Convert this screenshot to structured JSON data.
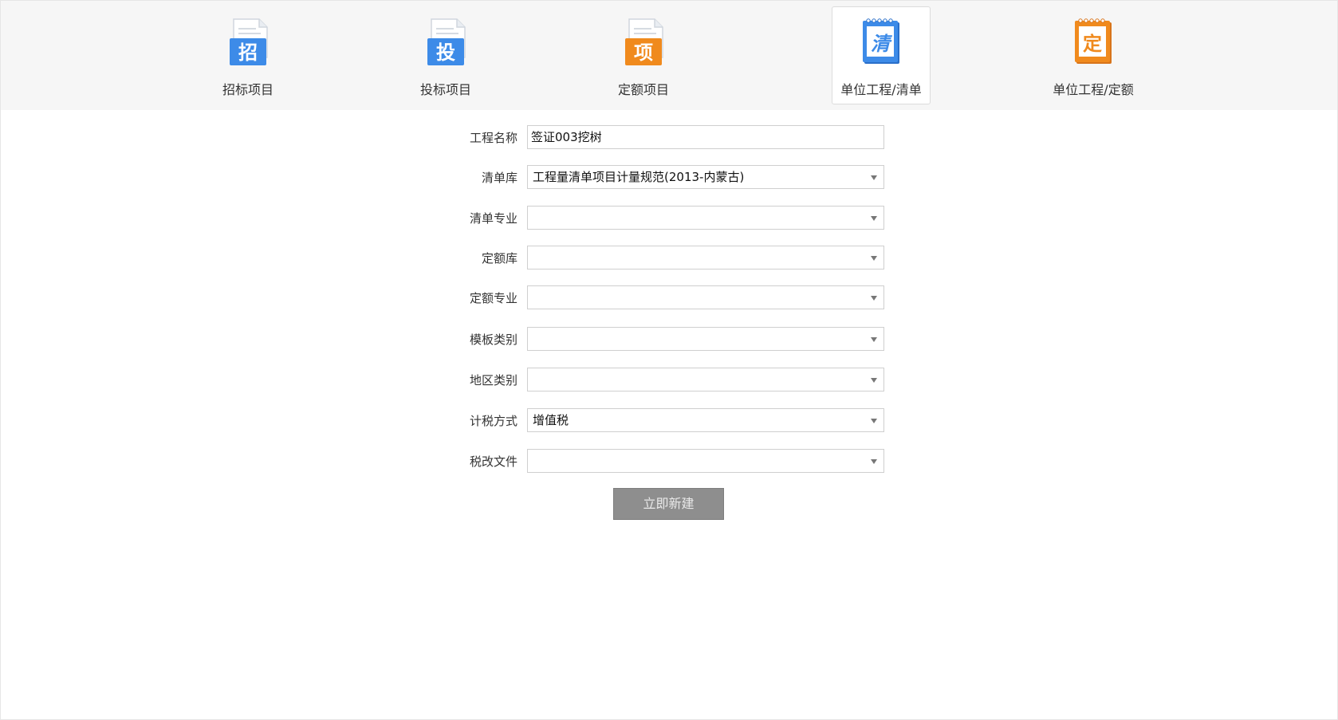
{
  "tabs": [
    {
      "label": "招标项目",
      "icon": "zhao-doc-icon",
      "glyph": "招",
      "color": "#3d8be8",
      "active": false
    },
    {
      "label": "投标项目",
      "icon": "tou-doc-icon",
      "glyph": "投",
      "color": "#3d8be8",
      "active": false
    },
    {
      "label": "定额项目",
      "icon": "xiang-doc-icon",
      "glyph": "项",
      "color": "#f08a1d",
      "active": false
    },
    {
      "label": "单位工程/清单",
      "icon": "qing-notepad-icon",
      "glyph": "清",
      "color": "#3d8be8",
      "active": true
    },
    {
      "label": "单位工程/定额",
      "icon": "ding-notepad-icon",
      "glyph": "定",
      "color": "#f08a1d",
      "active": false
    }
  ],
  "form": {
    "project_name": {
      "label": "工程名称",
      "value": "签证003挖树"
    },
    "list_library": {
      "label": "清单库",
      "value": "工程量清单项目计量规范(2013-内蒙古)"
    },
    "list_specialty": {
      "label": "清单专业",
      "value": ""
    },
    "quota_library": {
      "label": "定额库",
      "value": ""
    },
    "quota_specialty": {
      "label": "定额专业",
      "value": ""
    },
    "template_type": {
      "label": "模板类别",
      "value": ""
    },
    "region_type": {
      "label": "地区类别",
      "value": ""
    },
    "tax_method": {
      "label": "计税方式",
      "value": "增值税"
    },
    "tax_reform_doc": {
      "label": "税改文件",
      "value": ""
    }
  },
  "submit_label": "立即新建",
  "colors": {
    "blue": "#3d8be8",
    "orange": "#f08a1d",
    "button_gray": "#8e8e8e",
    "topbar_bg": "#f6f6f6"
  }
}
